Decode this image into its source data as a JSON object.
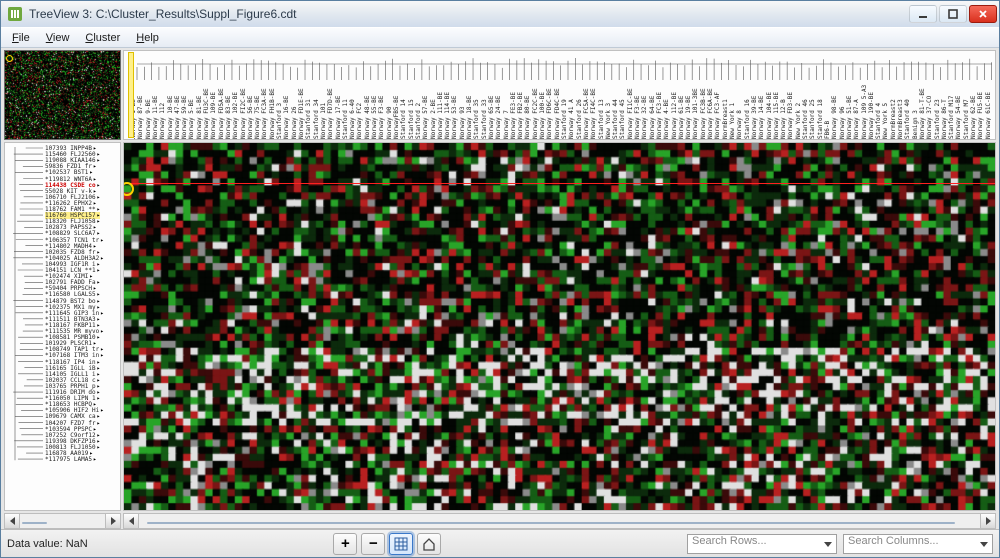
{
  "window": {
    "title": "TreeView 3: C:\\Cluster_Results\\Suppl_Figure6.cdt"
  },
  "menubar": {
    "file": "File",
    "view": "View",
    "cluster": "Cluster",
    "help": "Help"
  },
  "status": {
    "data_value_label": "Data value:",
    "data_value": "NaN"
  },
  "toolbar": {
    "zoom_in": "+",
    "zoom_out": "−",
    "reset_tip": "reset-zoom",
    "home_tip": "home",
    "search_rows_placeholder": "Search Rows...",
    "search_cols_placeholder": "Search Columns..."
  },
  "icons": {
    "min": "minimize",
    "max": "maximize",
    "close": "close"
  },
  "rows": {
    "line_h": 6.1,
    "items": [
      {
        "id": "107393",
        "g": "INPP4B",
        "hl": ""
      },
      {
        "id": "115460",
        "g": "FLJ2560",
        "hl": ""
      },
      {
        "id": "119088",
        "g": "KIAA146",
        "hl": ""
      },
      {
        "id": "59836",
        "g": "FZD1 fr",
        "hl": ""
      },
      {
        "id": "*102537",
        "g": "BST1",
        "hl": ""
      },
      {
        "id": "*119812",
        "g": "WNT6A",
        "hl": ""
      },
      {
        "id": "114438",
        "g": "CSDE co",
        "hl": "red"
      },
      {
        "id": "55028",
        "g": "KIT v-k",
        "hl": ""
      },
      {
        "id": "106710",
        "g": "FLJ2106",
        "hl": ""
      },
      {
        "id": "*116262",
        "g": "EPHX2",
        "hl": ""
      },
      {
        "id": "118762",
        "g": "FAM1 **",
        "hl": ""
      },
      {
        "id": "116760",
        "g": "HSPC157",
        "hl": "yellow"
      },
      {
        "id": "118320",
        "g": "FLJ1058",
        "hl": ""
      },
      {
        "id": "102873",
        "g": "PAPSS2",
        "hl": ""
      },
      {
        "id": "*108829",
        "g": "SLC6A7",
        "hl": ""
      },
      {
        "id": "*106357",
        "g": "TCN1 tr",
        "hl": ""
      },
      {
        "id": "*114802",
        "g": "MADH4",
        "hl": ""
      },
      {
        "id": "102035",
        "g": "FZD8 fr",
        "hl": ""
      },
      {
        "id": "*104025",
        "g": "ALDH3A2",
        "hl": ""
      },
      {
        "id": "104993",
        "g": "IGF1R i",
        "hl": ""
      },
      {
        "id": "104151",
        "g": "LCN **1",
        "hl": ""
      },
      {
        "id": "*102474",
        "g": "XIMI",
        "hl": ""
      },
      {
        "id": "102791",
        "g": "FADD Fa",
        "hl": ""
      },
      {
        "id": "*59404",
        "g": "PRPSCH",
        "hl": ""
      },
      {
        "id": "*116580",
        "g": "LGALS5",
        "hl": ""
      },
      {
        "id": "114879",
        "g": "BST2 bo",
        "hl": ""
      },
      {
        "id": "*102375",
        "g": "MX1 my",
        "hl": ""
      },
      {
        "id": "*111645",
        "g": "GIP3 in",
        "hl": ""
      },
      {
        "id": "*111511",
        "g": "BTN3A3",
        "hl": ""
      },
      {
        "id": "*118167",
        "g": "FKBP11",
        "hl": ""
      },
      {
        "id": "*111535",
        "g": "MR myvo",
        "hl": ""
      },
      {
        "id": "*108581",
        "g": "PSMB10",
        "hl": ""
      },
      {
        "id": "101929",
        "g": "PLSCR1",
        "hl": ""
      },
      {
        "id": "*108749",
        "g": "TAP1 tr",
        "hl": ""
      },
      {
        "id": "*107168",
        "g": "ITM3 in",
        "hl": ""
      },
      {
        "id": "*118167",
        "g": "IP4 in",
        "hl": ""
      },
      {
        "id": "116165",
        "g": "IGLL iB",
        "hl": ""
      },
      {
        "id": "114105",
        "g": "IGLL1 i",
        "hl": ""
      },
      {
        "id": "102037",
        "g": "CCL18 c",
        "hl": ""
      },
      {
        "id": "103765",
        "g": "PRPH1 p",
        "hl": ""
      },
      {
        "id": "111916",
        "g": "DRIM do",
        "hl": ""
      },
      {
        "id": "*116050",
        "g": "LIPN 1",
        "hl": ""
      },
      {
        "id": "*118653",
        "g": "HCBPQ",
        "hl": ""
      },
      {
        "id": "*105906",
        "g": "HIF2 Hi",
        "hl": ""
      },
      {
        "id": "109679",
        "g": "CAMX ca",
        "hl": ""
      },
      {
        "id": "104207",
        "g": "FZD7 fr",
        "hl": ""
      },
      {
        "id": "*103594",
        "g": "PPSPC",
        "hl": ""
      },
      {
        "id": "107252",
        "g": "C9orf12",
        "hl": ""
      },
      {
        "id": "119398",
        "g": "DKFZP16",
        "hl": ""
      },
      {
        "id": "100813",
        "g": "FLJ1050",
        "hl": ""
      },
      {
        "id": "116878",
        "g": "AA019",
        "hl": ""
      },
      {
        "id": "*117975",
        "g": "LAMA5",
        "hl": ""
      }
    ]
  },
  "cols": {
    "highlight_index": 0,
    "items": [
      "Norway 1-BE",
      "Norway 87-BE",
      "Norway 9-BE",
      "Norway 11-BE",
      "Norway 112",
      "Norway 10-BE",
      "Norway 47-BE",
      "Norway 59-BE",
      "Norway 5-BE",
      "Norway 81-BE",
      "Norway FU3C-BE",
      "Norway 109-BE",
      "Norway FD5A-BE",
      "Norway 83-BE",
      "Norway 102-BE",
      "Norway FI2C-BE",
      "Norway 56-BE",
      "Norway 75-BE",
      "Norway FC3A-BE",
      "Norway FH1B-BE",
      "Stanford 3",
      "Norway 16-BE",
      "Norway 26",
      "Norway FD1E-BE",
      "Stanford 31",
      "Stanford 34",
      "Norway 101",
      "Norway FD7D-BE",
      "Norway 17-BE",
      "Stanford 11",
      "Norway 6-40",
      "Norway FC2",
      "Norway 48-BE",
      "Norway 55-BE",
      "Norway F3-BE",
      "Norway 90",
      "NorwayFB5-BE",
      "Stanford 14",
      "Stanford 15",
      "Stanford 2",
      "Norway 57-BE",
      "Norway 2-BE",
      "Norway 111-BE",
      "Norway 114-BE",
      "Norway 53-BE",
      "Norway 93",
      "Norway 18-BE",
      "Stanford 35",
      "Stanford 33",
      "Norway 65-BE",
      "Norway 24-BE",
      "Norway 7",
      "Norway FE3-BE",
      "Norway FB2-BE",
      "Norway 80-BE",
      "Norway FC2C-BE",
      "Norway 100-BE",
      "Norway FD6C-BE",
      "Norway FD4C-BE",
      "Stanford 19",
      "Norway 41 A",
      "Stanford 26",
      "Norway FC5A-BE",
      "Norway FI4C-BE",
      "Stanford 13",
      "New York 3",
      "Stanford 44",
      "Stanford 45",
      "Norway FI1C-BE",
      "Norway F3-BE",
      "Norway 32-BE",
      "Norway 64-BE",
      "Norway FC3-BE",
      "Norway 4-BE",
      "Norway 112-BE",
      "Norway 61-BE",
      "Norway 19-BE",
      "Norway 101-3BE",
      "Norway FC3B-BE",
      "Norway FC6A-BE",
      "Norway FC3-AF",
      "NormBreast1",
      "New York 1",
      "Norway 8",
      "Stanford 16",
      "Norway 39-BE",
      "Norway 14-BE",
      "Norway 104-BE",
      "Norway 115-BE",
      "Norway 12-B",
      "Norway FD3-BE",
      "New York 2",
      "Stanford 46",
      "Stanford 25",
      "Stanford 18",
      "FB6-B",
      "Norway 98-BE",
      "Norway 96",
      "Norway 51-BE",
      "Norway 87-A",
      "Norway 109 5-A3",
      "Norway 190-BE",
      "Stanford 4",
      "New York 5",
      "NormBreast2",
      "NormBreast3",
      "Stanford 40",
      "Benign 3",
      "Norway 81-T-BE",
      "Norway 37-CO",
      "Stanford 23",
      "Norway 86-T",
      "Stanford M17",
      "Norway 54-BE",
      "Stanford M7",
      "Norway 62-BE",
      "Norway FU5-BE",
      "Norway 61C-BE"
    ]
  },
  "heatmap": {
    "rows": 52,
    "cols": 118,
    "circle_row": 7,
    "circle_col": 0,
    "redline_row": 6,
    "seed": 91273
  },
  "scrollbars": {
    "row_thumb_pct": [
      2,
      30
    ],
    "col_thumb_pct": [
      1,
      96
    ]
  },
  "misc": {
    "highlight_circle_label": "selection-marker"
  }
}
